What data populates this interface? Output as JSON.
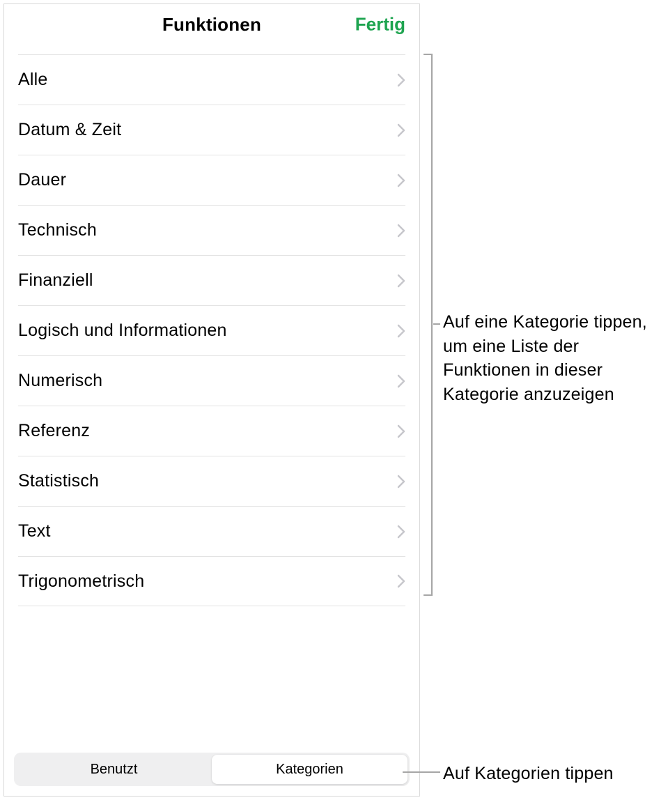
{
  "header": {
    "title": "Funktionen",
    "done": "Fertig"
  },
  "categories": [
    {
      "label": "Alle"
    },
    {
      "label": "Datum & Zeit"
    },
    {
      "label": "Dauer"
    },
    {
      "label": "Technisch"
    },
    {
      "label": "Finanziell"
    },
    {
      "label": "Logisch und Informationen"
    },
    {
      "label": "Numerisch"
    },
    {
      "label": "Referenz"
    },
    {
      "label": "Statistisch"
    },
    {
      "label": "Text"
    },
    {
      "label": "Trigonometrisch"
    }
  ],
  "footer": {
    "segments": {
      "used": "Benutzt",
      "categories": "Kategorien"
    },
    "active": "categories"
  },
  "callouts": {
    "categories": "Auf eine Kategorie tippen, um eine Liste der Funktionen in dieser Kategorie anzuzeigen",
    "footer": "Auf Kategorien tippen"
  }
}
